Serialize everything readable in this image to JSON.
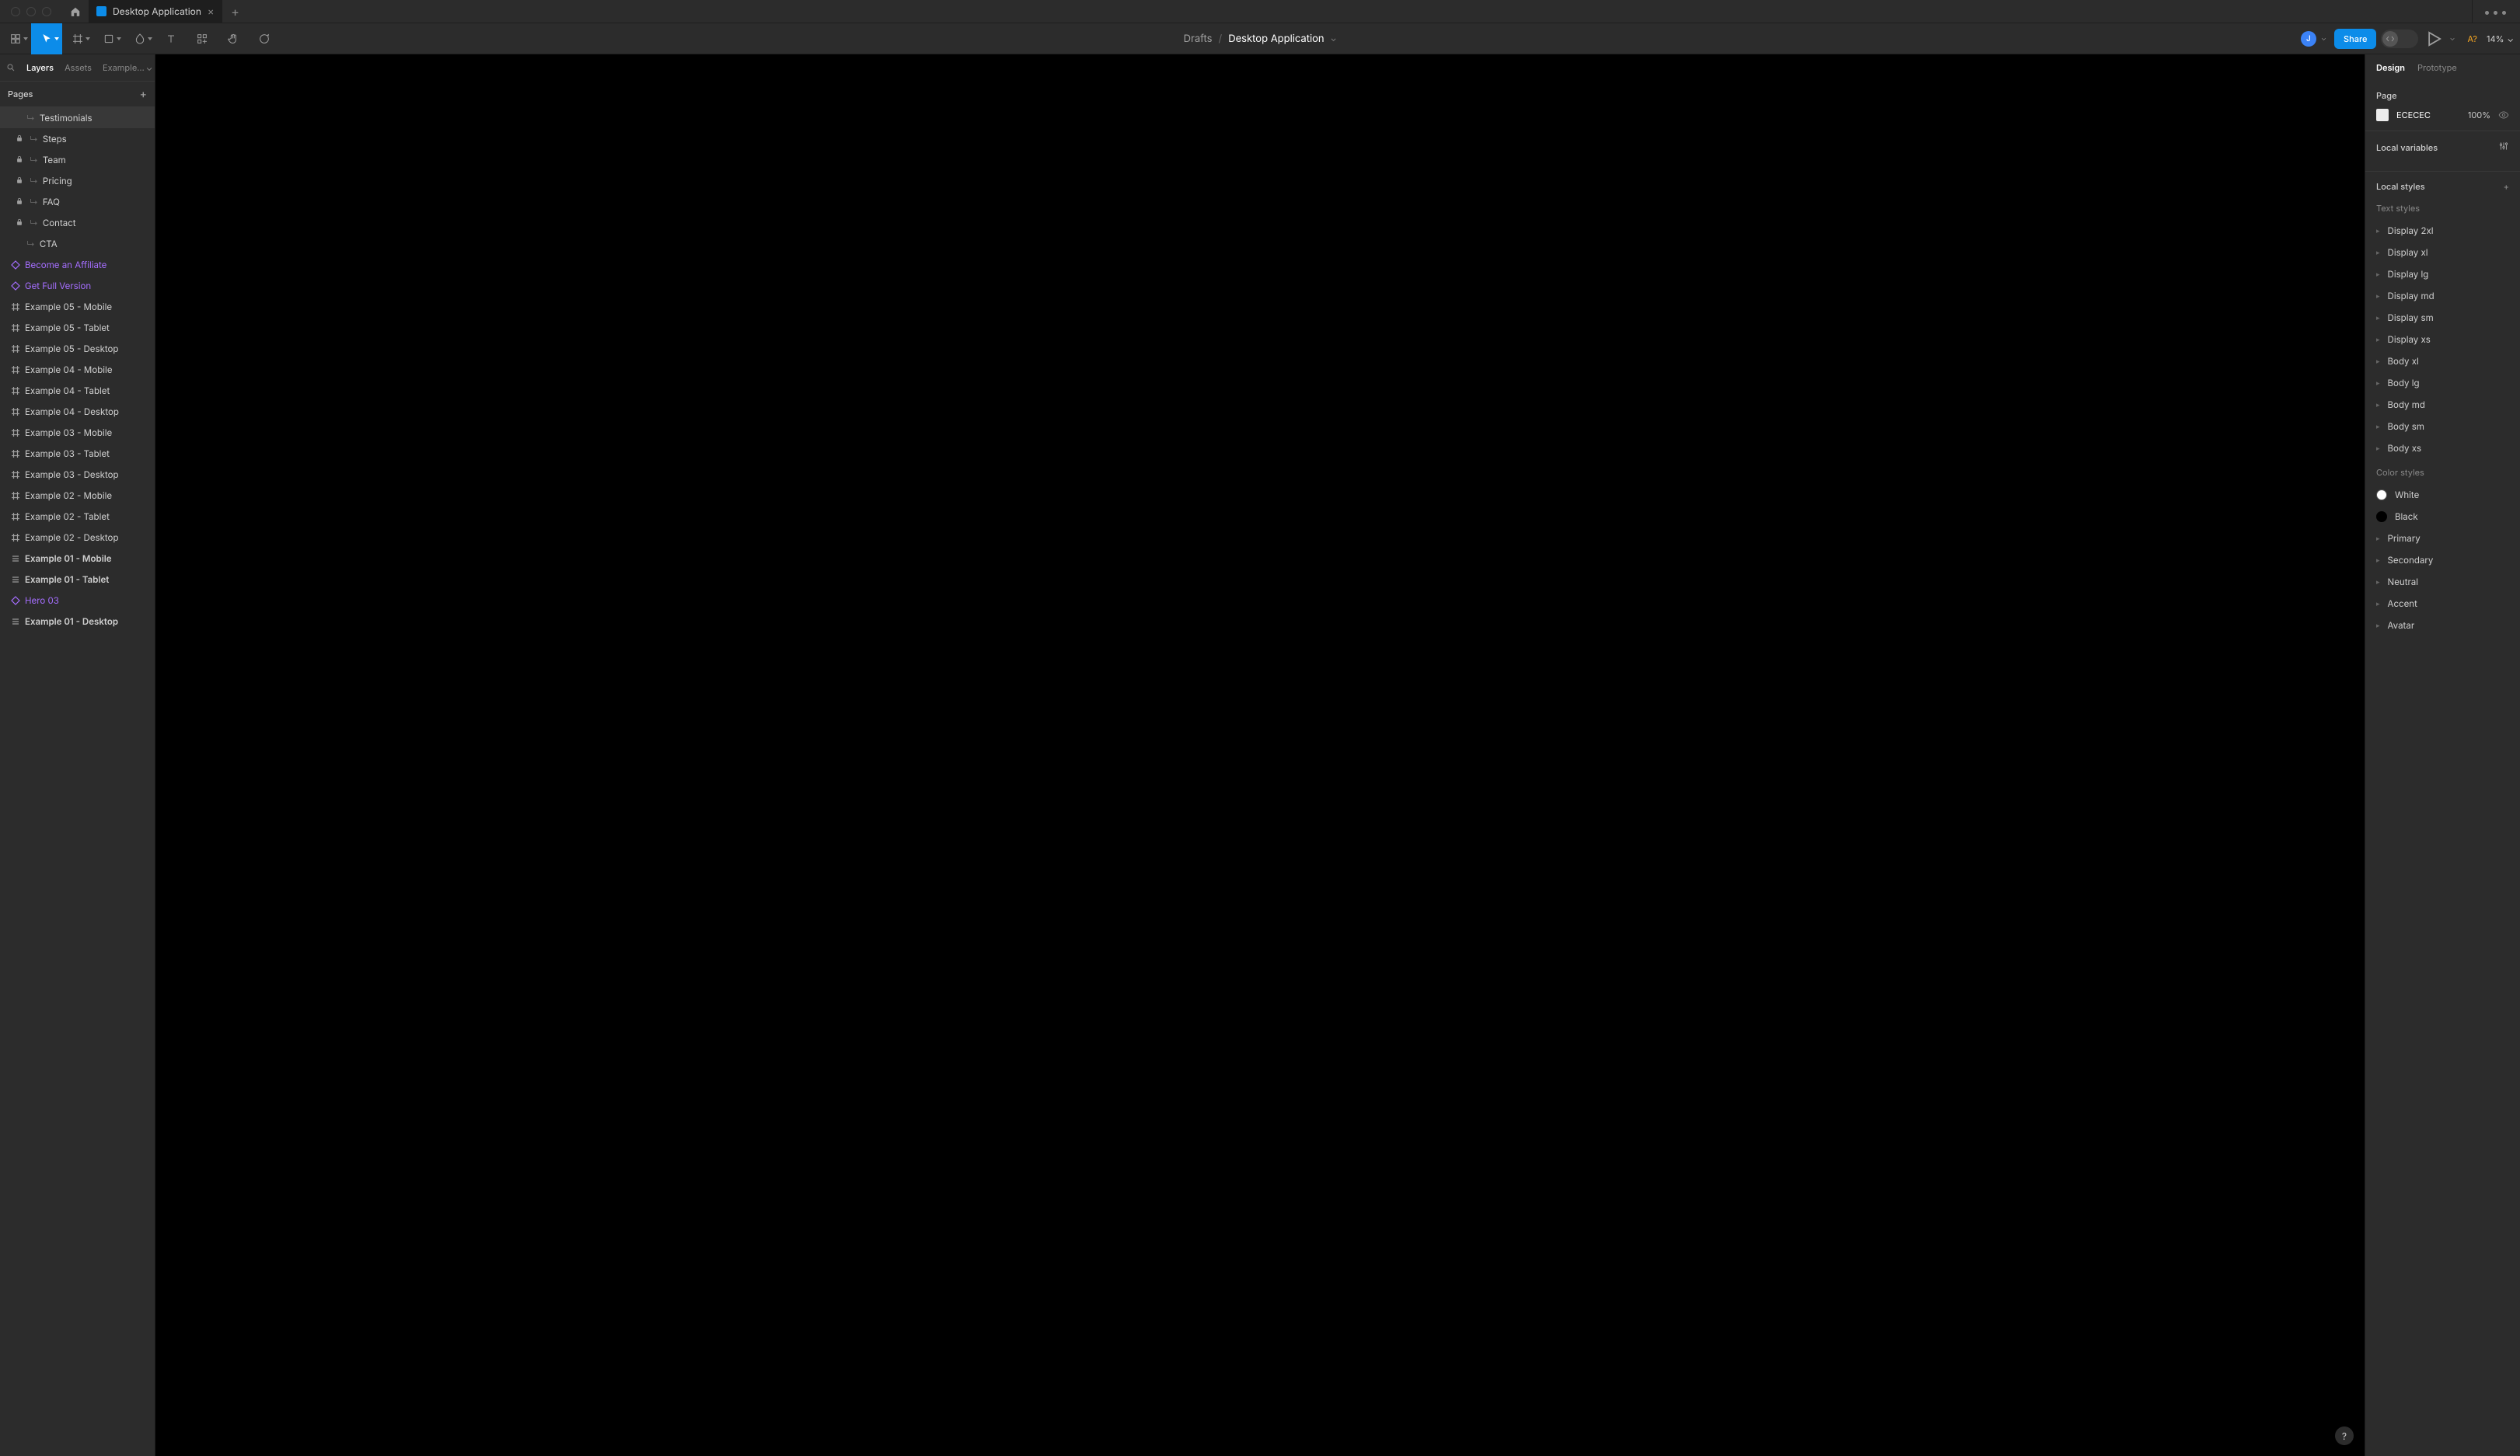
{
  "titlebar": {
    "tab_title": "Desktop Application"
  },
  "toolbar": {
    "breadcrumb_parent": "Drafts",
    "breadcrumb_current": "Desktop Application",
    "avatar_initial": "J",
    "share_label": "Share",
    "ab_label": "A?",
    "zoom": "14%"
  },
  "left": {
    "search_placeholder": "Search",
    "tabs": {
      "layers": "Layers",
      "assets": "Assets",
      "example": "Example…"
    },
    "pages_label": "Pages",
    "layers": [
      {
        "name": "Testimonials",
        "indent": 20,
        "locked": false,
        "sub": true,
        "icon": "none",
        "bold": false,
        "purple": false,
        "selected": true
      },
      {
        "name": "Steps",
        "indent": 6,
        "locked": true,
        "sub": true,
        "icon": "none",
        "bold": false,
        "purple": false,
        "selected": false
      },
      {
        "name": "Team",
        "indent": 6,
        "locked": true,
        "sub": true,
        "icon": "none",
        "bold": false,
        "purple": false,
        "selected": false
      },
      {
        "name": "Pricing",
        "indent": 6,
        "locked": true,
        "sub": true,
        "icon": "none",
        "bold": false,
        "purple": false,
        "selected": false
      },
      {
        "name": "FAQ",
        "indent": 6,
        "locked": true,
        "sub": true,
        "icon": "none",
        "bold": false,
        "purple": false,
        "selected": false
      },
      {
        "name": "Contact",
        "indent": 6,
        "locked": true,
        "sub": true,
        "icon": "none",
        "bold": false,
        "purple": false,
        "selected": false
      },
      {
        "name": "CTA",
        "indent": 20,
        "locked": false,
        "sub": true,
        "icon": "none",
        "bold": false,
        "purple": false,
        "selected": false
      },
      {
        "name": "Become an Affiliate",
        "indent": 0,
        "locked": false,
        "sub": false,
        "icon": "diamond",
        "bold": false,
        "purple": true,
        "selected": false
      },
      {
        "name": "Get Full Version",
        "indent": 0,
        "locked": false,
        "sub": false,
        "icon": "diamond",
        "bold": false,
        "purple": true,
        "selected": false
      },
      {
        "name": "Example 05 - Mobile",
        "indent": 0,
        "locked": false,
        "sub": false,
        "icon": "frame",
        "bold": false,
        "purple": false,
        "selected": false
      },
      {
        "name": "Example 05 - Tablet",
        "indent": 0,
        "locked": false,
        "sub": false,
        "icon": "frame",
        "bold": false,
        "purple": false,
        "selected": false
      },
      {
        "name": "Example 05 - Desktop",
        "indent": 0,
        "locked": false,
        "sub": false,
        "icon": "frame",
        "bold": false,
        "purple": false,
        "selected": false
      },
      {
        "name": "Example 04 - Mobile",
        "indent": 0,
        "locked": false,
        "sub": false,
        "icon": "frame",
        "bold": false,
        "purple": false,
        "selected": false
      },
      {
        "name": "Example 04 - Tablet",
        "indent": 0,
        "locked": false,
        "sub": false,
        "icon": "frame",
        "bold": false,
        "purple": false,
        "selected": false
      },
      {
        "name": "Example 04 - Desktop",
        "indent": 0,
        "locked": false,
        "sub": false,
        "icon": "frame",
        "bold": false,
        "purple": false,
        "selected": false
      },
      {
        "name": "Example 03 - Mobile",
        "indent": 0,
        "locked": false,
        "sub": false,
        "icon": "frame",
        "bold": false,
        "purple": false,
        "selected": false
      },
      {
        "name": "Example 03 - Tablet",
        "indent": 0,
        "locked": false,
        "sub": false,
        "icon": "frame",
        "bold": false,
        "purple": false,
        "selected": false
      },
      {
        "name": "Example 03 - Desktop",
        "indent": 0,
        "locked": false,
        "sub": false,
        "icon": "frame",
        "bold": false,
        "purple": false,
        "selected": false
      },
      {
        "name": "Example 02 - Mobile",
        "indent": 0,
        "locked": false,
        "sub": false,
        "icon": "frame",
        "bold": false,
        "purple": false,
        "selected": false
      },
      {
        "name": "Example 02 - Tablet",
        "indent": 0,
        "locked": false,
        "sub": false,
        "icon": "frame",
        "bold": false,
        "purple": false,
        "selected": false
      },
      {
        "name": "Example 02 - Desktop",
        "indent": 0,
        "locked": false,
        "sub": false,
        "icon": "frame",
        "bold": false,
        "purple": false,
        "selected": false
      },
      {
        "name": "Example 01 - Mobile",
        "indent": 0,
        "locked": false,
        "sub": false,
        "icon": "autolayout",
        "bold": true,
        "purple": false,
        "selected": false
      },
      {
        "name": "Example 01 - Tablet",
        "indent": 0,
        "locked": false,
        "sub": false,
        "icon": "autolayout",
        "bold": true,
        "purple": false,
        "selected": false
      },
      {
        "name": "Hero 03",
        "indent": 0,
        "locked": false,
        "sub": false,
        "icon": "diamond",
        "bold": false,
        "purple": true,
        "selected": false
      },
      {
        "name": "Example 01 - Desktop",
        "indent": 0,
        "locked": false,
        "sub": false,
        "icon": "autolayout",
        "bold": true,
        "purple": false,
        "selected": false
      }
    ]
  },
  "right": {
    "tabs": {
      "design": "Design",
      "prototype": "Prototype"
    },
    "page": {
      "label": "Page",
      "hex": "ECECEC",
      "opacity": "100%"
    },
    "local_variables_label": "Local variables",
    "local_styles_label": "Local styles",
    "text_styles_label": "Text styles",
    "text_styles": [
      "Display 2xl",
      "Display xl",
      "Display lg",
      "Display md",
      "Display sm",
      "Display xs",
      "Body xl",
      "Body lg",
      "Body md",
      "Body sm",
      "Body xs"
    ],
    "color_styles_label": "Color styles",
    "color_styles": [
      {
        "name": "White",
        "type": "solid",
        "color": "#ffffff"
      },
      {
        "name": "Black",
        "type": "solid",
        "color": "#000000"
      },
      {
        "name": "Primary",
        "type": "group"
      },
      {
        "name": "Secondary",
        "type": "group"
      },
      {
        "name": "Neutral",
        "type": "group"
      },
      {
        "name": "Accent",
        "type": "group"
      },
      {
        "name": "Avatar",
        "type": "group"
      }
    ]
  }
}
